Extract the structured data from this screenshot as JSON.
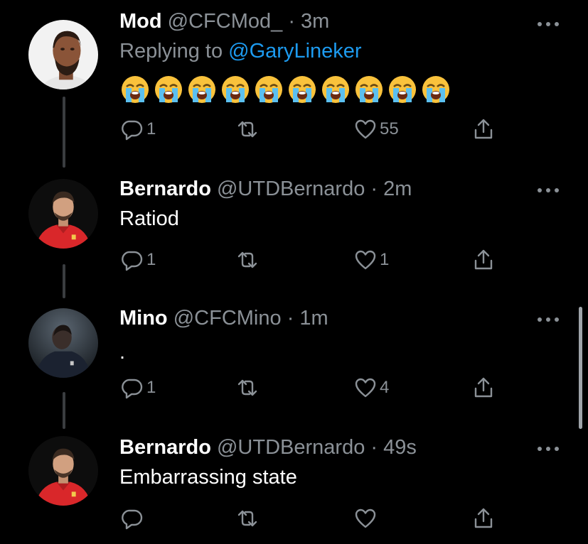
{
  "tweets": [
    {
      "name": "Mod",
      "handle": "@CFCMod_",
      "time": "3m",
      "replying_prefix": "Replying to ",
      "replying_to": "@GaryLineker",
      "emoji_name": "loudly-crying-face",
      "emoji_count": 10,
      "reply_count": "1",
      "retweet_count": "",
      "like_count": "55",
      "avatar": "man-profile-photo"
    },
    {
      "name": "Bernardo",
      "handle": "@UTDBernardo",
      "time": "2m",
      "text": "Ratiod",
      "reply_count": "1",
      "retweet_count": "",
      "like_count": "1",
      "avatar": "footballer-red-kit-photo"
    },
    {
      "name": "Mino",
      "handle": "@CFCMino",
      "time": "1m",
      "text": ".",
      "reply_count": "1",
      "retweet_count": "",
      "like_count": "4",
      "avatar": "footballer-dark-photo"
    },
    {
      "name": "Bernardo",
      "handle": "@UTDBernardo",
      "time": "49s",
      "text": "Embarrassing state",
      "reply_count": "",
      "retweet_count": "",
      "like_count": "",
      "avatar": "footballer-red-kit-photo"
    }
  ],
  "separator": "·",
  "colors": {
    "background": "#000000",
    "primary_text": "#ffffff",
    "secondary_text": "#8b9197",
    "mention": "#1d9bf0",
    "thread_line": "#3a3d40"
  },
  "icons": {
    "reply": "reply-icon",
    "retweet": "retweet-icon",
    "like": "heart-icon",
    "share": "share-icon",
    "more": "more-dots-icon"
  }
}
